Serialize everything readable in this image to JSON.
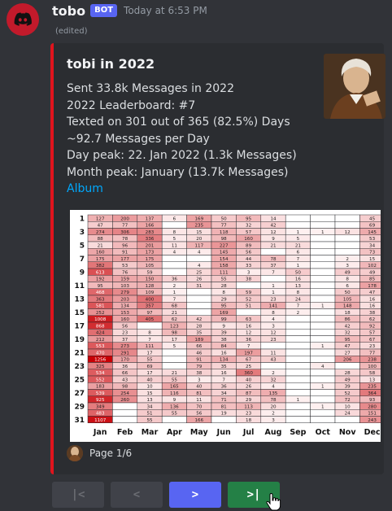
{
  "message": {
    "username": "tobo",
    "badge": "BOT",
    "timestamp": "Today at 6:53 PM",
    "edited": "(edited)"
  },
  "embed": {
    "title": "tobi in 2022",
    "lines": [
      "Sent 33.8k Messages in 2022",
      "2022 Leaderboard: #7",
      "Texted on 301 out of 365 (82.5%) Days",
      "~92.7 Messages per Day",
      "Day peak: 22. Jan 2022 (1.3k Messages)",
      "Month peak: January (13.7k Messages)"
    ],
    "link": "Album",
    "footer": "Page 1/6",
    "accent": "#e0141d"
  },
  "buttons": {
    "first": "|<",
    "prev": "<",
    "next": ">",
    "last": ">|"
  },
  "chart_data": {
    "type": "heatmap",
    "x_categories": [
      "Jan",
      "Feb",
      "Mar",
      "Apr",
      "May",
      "Jun",
      "Jul",
      "Aug",
      "Sep",
      "Oct",
      "Nov",
      "Dec"
    ],
    "y_categories": [
      "1",
      "2",
      "3",
      "4",
      "5",
      "6",
      "7",
      "8",
      "9",
      "10",
      "11",
      "12",
      "13",
      "14",
      "15",
      "16",
      "17",
      "18",
      "19",
      "20",
      "21",
      "22",
      "23",
      "24",
      "25",
      "26",
      "27",
      "28",
      "29",
      "30",
      "31"
    ],
    "values": [
      [
        "127",
        "200",
        "137",
        "6",
        "169",
        "50",
        "95",
        "14",
        "",
        "",
        "",
        "45"
      ],
      [
        "47",
        "77",
        "166",
        "",
        "235",
        "77",
        "32",
        "42",
        "",
        "",
        "",
        "69"
      ],
      [
        "274",
        "306",
        "283",
        "8",
        "15",
        "118",
        "57",
        "12",
        "1",
        "1",
        "12",
        "145"
      ],
      [
        "88",
        "78",
        "336",
        "5",
        "20",
        "98",
        "160",
        "9",
        "5",
        "",
        "",
        "53"
      ],
      [
        "21",
        "96",
        "201",
        "11",
        "117",
        "227",
        "89",
        "21",
        "21",
        "",
        "",
        "34"
      ],
      [
        "160",
        "91",
        "173",
        "4",
        "4",
        "145",
        "56",
        "",
        "6",
        "",
        "",
        "73"
      ],
      [
        "175",
        "177",
        "175",
        "",
        "",
        "154",
        "44",
        "78",
        "7",
        "",
        "2",
        "15"
      ],
      [
        "382",
        "53",
        "105",
        "",
        "4",
        "158",
        "33",
        "37",
        "1",
        "",
        "3",
        "102"
      ],
      [
        "613",
        "76",
        "59",
        "",
        "25",
        "111",
        "3",
        "7",
        "50",
        "",
        "49",
        "49"
      ],
      [
        "192",
        "159",
        "150",
        "36",
        "26",
        "55",
        "38",
        "",
        "16",
        "",
        "8",
        "85"
      ],
      [
        "95",
        "103",
        "128",
        "2",
        "31",
        "28",
        "",
        "1",
        "13",
        "",
        "6",
        "178"
      ],
      [
        "468",
        "279",
        "109",
        "1",
        "",
        "8",
        "59",
        "1",
        "8",
        "",
        "50",
        "47"
      ],
      [
        "363",
        "203",
        "400",
        "7",
        "",
        "29",
        "52",
        "23",
        "24",
        "",
        "105",
        "16"
      ],
      [
        "581",
        "134",
        "357",
        "68",
        "",
        "95",
        "51",
        "141",
        "7",
        "1",
        "148",
        "16"
      ],
      [
        "252",
        "153",
        "97",
        "21",
        "",
        "169",
        "",
        "8",
        "2",
        "",
        "18",
        "38"
      ],
      [
        "1008",
        "160",
        "405",
        "62",
        "42",
        "99",
        "63",
        "4",
        "",
        "",
        "86",
        "62"
      ],
      [
        "868",
        "56",
        "",
        "123",
        "28",
        "9",
        "16",
        "3",
        "",
        "",
        "42",
        "92"
      ],
      [
        "424",
        "23",
        "8",
        "98",
        "35",
        "39",
        "12",
        "12",
        "",
        "",
        "32",
        "57"
      ],
      [
        "212",
        "37",
        "7",
        "17",
        "189",
        "38",
        "36",
        "23",
        "",
        "",
        "95",
        "67"
      ],
      [
        "553",
        "273",
        "111",
        "5",
        "66",
        "84",
        "7",
        "",
        "",
        "1",
        "47",
        "23"
      ],
      [
        "470",
        "291",
        "17",
        "",
        "46",
        "16",
        "197",
        "11",
        "",
        "",
        "27",
        "77"
      ],
      [
        "1256",
        "170",
        "55",
        "",
        "91",
        "134",
        "67",
        "43",
        "",
        "",
        "206",
        "238"
      ],
      [
        "325",
        "36",
        "69",
        "",
        "79",
        "35",
        "25",
        "",
        "",
        "4",
        "",
        "100"
      ],
      [
        "534",
        "66",
        "17",
        "21",
        "38",
        "16",
        "360",
        "2",
        "",
        "",
        "28",
        "58"
      ],
      [
        "552",
        "43",
        "40",
        "55",
        "3",
        "7",
        "40",
        "32",
        "",
        "",
        "49",
        "13"
      ],
      [
        "183",
        "98",
        "10",
        "165",
        "40",
        "36",
        "26",
        "4",
        "",
        "1",
        "39",
        "235"
      ],
      [
        "539",
        "254",
        "15",
        "116",
        "81",
        "34",
        "87",
        "135",
        "",
        "",
        "52",
        "364"
      ],
      [
        "925",
        "260",
        "13",
        "9",
        "11",
        "71",
        "29",
        "78",
        "1",
        "",
        "72",
        "93"
      ],
      [
        "349",
        "",
        "34",
        "136",
        "70",
        "81",
        "113",
        "20",
        "",
        "1",
        "10",
        "280"
      ],
      [
        "483",
        "",
        "51",
        "55",
        "56",
        "19",
        "23",
        "2",
        "",
        "",
        "24",
        "151"
      ],
      [
        "1107",
        "",
        "55",
        "",
        "166",
        "",
        "18",
        "3",
        "",
        "",
        "",
        "243"
      ]
    ]
  }
}
